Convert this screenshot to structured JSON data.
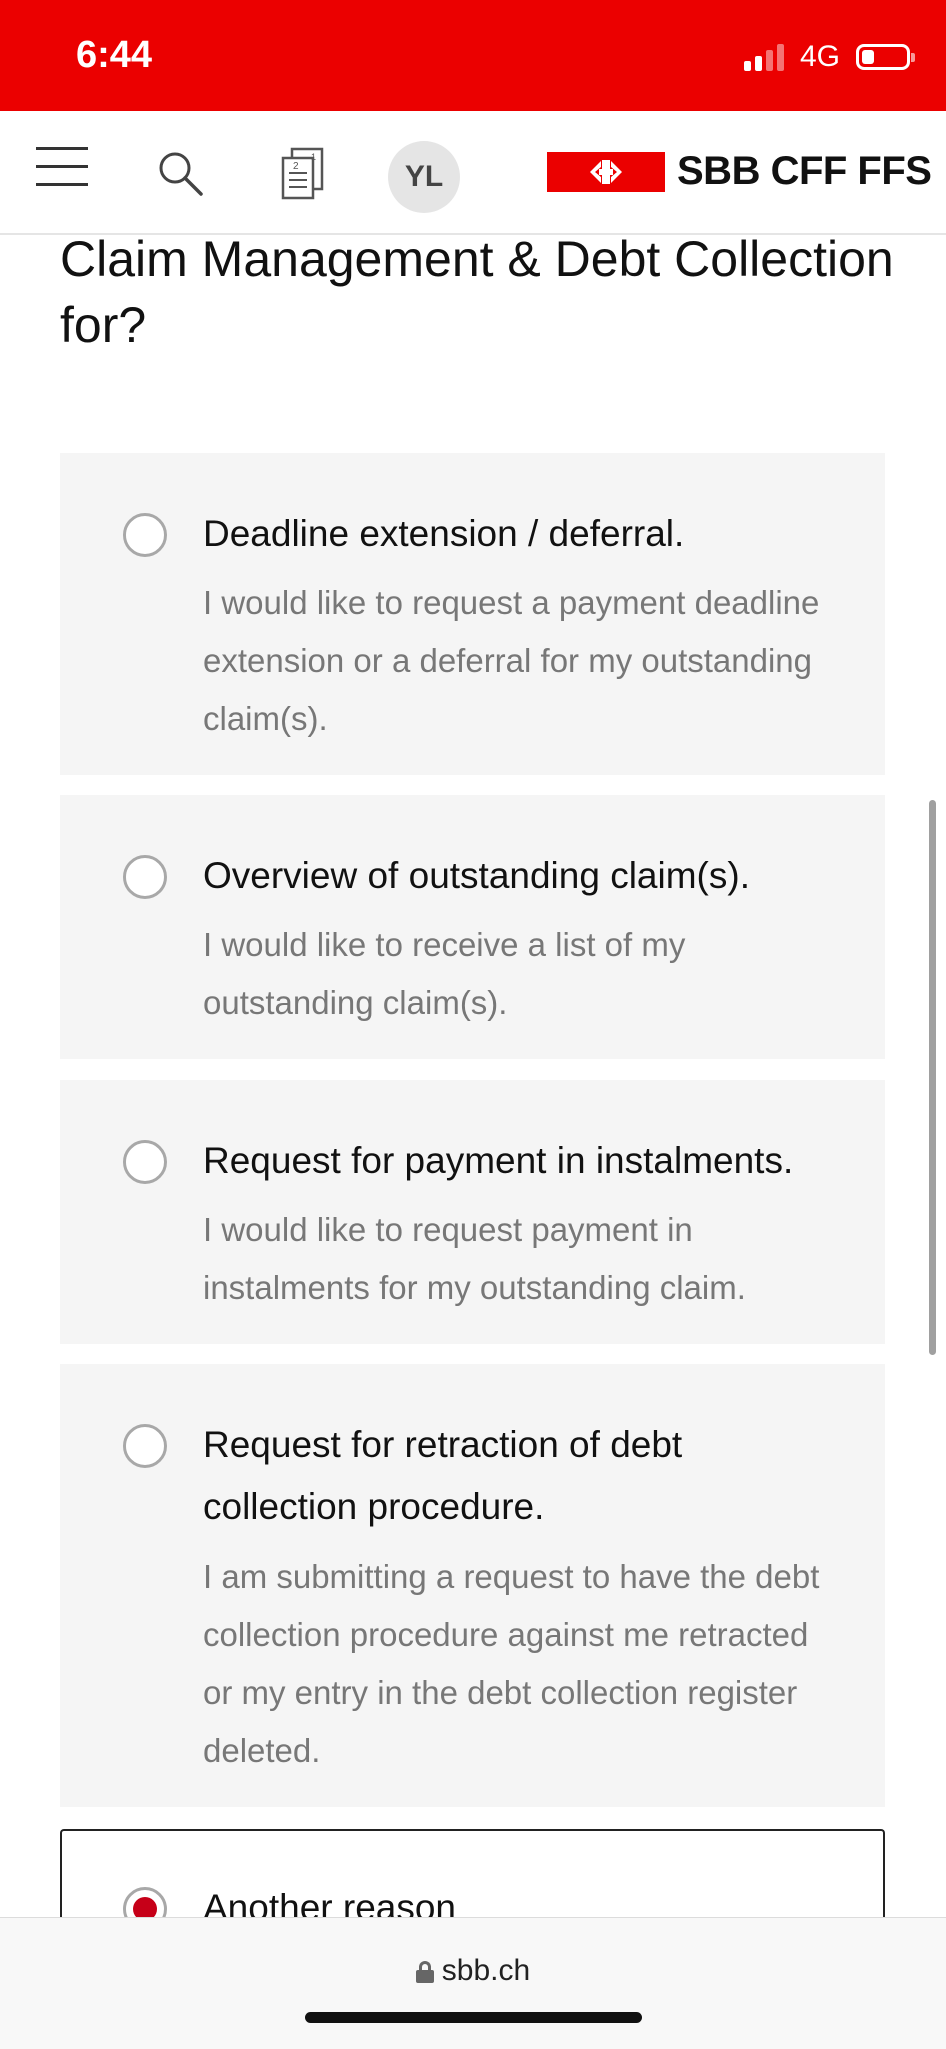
{
  "status_bar": {
    "time": "6:44",
    "network": "4G",
    "colors": {
      "background": "#eb0000"
    }
  },
  "header": {
    "avatar_initials": "YL",
    "logo_text": "SBB CFF FFS",
    "icons": [
      "menu-icon",
      "search-icon",
      "tickets-icon",
      "sbb-logo-icon"
    ]
  },
  "question": {
    "title": "Claim Management & Debt Collection for?"
  },
  "options": [
    {
      "title": "Deadline extension / deferral.",
      "description": "I would like to request a payment deadline extension or a deferral for my outstanding claim(s).",
      "selected": false
    },
    {
      "title": "Overview of outstanding claim(s).",
      "description": "I would like to receive a list of my outstanding claim(s).",
      "selected": false
    },
    {
      "title": "Request for payment in instalments.",
      "description": "I would like to request payment in instalments for my outstanding claim.",
      "selected": false
    },
    {
      "title": "Request for retraction of debt collection procedure.",
      "description": "I am submitting a request to have the debt collection procedure against me retracted or my entry in the debt collection register deleted.",
      "selected": false
    },
    {
      "title": "Another reason",
      "description": "",
      "selected": true
    }
  ],
  "browser": {
    "url": "sbb.ch"
  },
  "colors": {
    "brand_red": "#eb0000",
    "radio_selected": "#c60018",
    "option_bg": "#f5f5f5",
    "description_text": "#777777"
  }
}
